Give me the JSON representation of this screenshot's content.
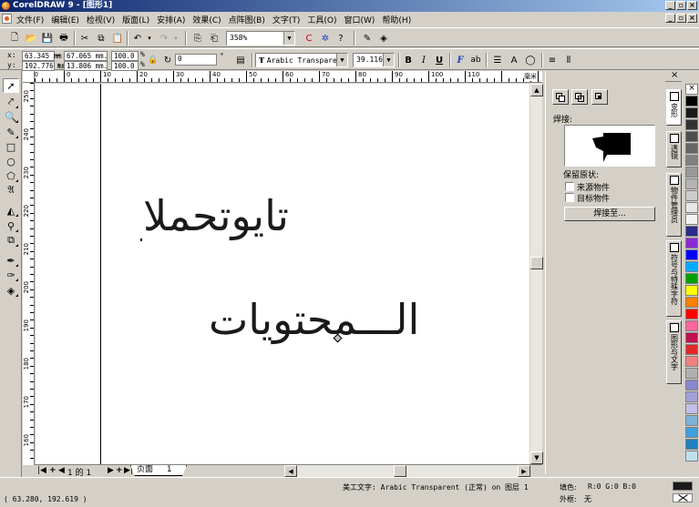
{
  "window": {
    "title": "CorelDRAW 9 - [图形1]"
  },
  "menu": [
    "文件(F)",
    "编辑(E)",
    "检视(V)",
    "版面(L)",
    "安排(A)",
    "效果(C)",
    "点阵图(B)",
    "文字(T)",
    "工具(O)",
    "窗口(W)",
    "帮助(H)"
  ],
  "toolbar": {
    "zoom": "358%"
  },
  "propbar": {
    "x_label": "x:",
    "x_value": "63.345 mm",
    "y_label": "y:",
    "y_value": "192.776 mm",
    "w_value": "67.065 mm.",
    "h_value": "13.806 mm.",
    "scale_x": "100.0",
    "scale_y": "100.0",
    "pct": "%",
    "rotation": "0",
    "deg": "°",
    "font": "Arabic Transparent",
    "font_size": "39.116",
    "bold": "B",
    "italic": "I",
    "underline": "U"
  },
  "ruler": {
    "unit": "毫米",
    "h_labels": [
      "10",
      "0",
      "10",
      "20",
      "30",
      "40",
      "50",
      "60",
      "70",
      "80",
      "90",
      "100",
      "110"
    ],
    "v_labels": [
      "250",
      "240",
      "230",
      "220",
      "210",
      "200",
      "190",
      "180",
      "170",
      "160"
    ]
  },
  "canvas": {
    "text1": "تايوتحملا",
    "text2": "الـــمحتويات"
  },
  "pages": {
    "counter": "1 的 1",
    "tab_label": "页面",
    "tab_number": "1"
  },
  "docker": {
    "weld_label": "焊接:",
    "keep_label": "保留原状:",
    "source_label": "来源物件",
    "target_label": "目标物件",
    "weld_button": "焊接至...",
    "tabs": [
      "变形",
      "透镜",
      "物件管理员",
      "符号与特殊字符",
      "图形与文字"
    ]
  },
  "palette": [
    "#ffffff",
    "#000000",
    "#1a1a1a",
    "#333333",
    "#4d4d4d",
    "#666666",
    "#808080",
    "#999999",
    "#b3b3b3",
    "#cccccc",
    "#e6e6e6",
    "#f2f2f2",
    "#2b2b8c",
    "#8c2bd4",
    "#0000ff",
    "#00aaff",
    "#00a000",
    "#ffff00",
    "#ff8000",
    "#ff0000",
    "#ff66a0",
    "#c01050",
    "#e02828",
    "#f08080",
    "#b0b0b0",
    "#8888cc",
    "#a0a0d8",
    "#c0c0e8",
    "#7fb0d8",
    "#40a0e0",
    "#2080c0",
    "#c0e0f0"
  ],
  "status": {
    "description": "美工文字: Arabic Transparent (正常) on 图层 1",
    "coords": "( 63.280, 192.619 )",
    "fill_label": "填色:",
    "fill_value": "R:0 G:0 B:0",
    "outline_label": "外框:",
    "outline_value": "无"
  }
}
